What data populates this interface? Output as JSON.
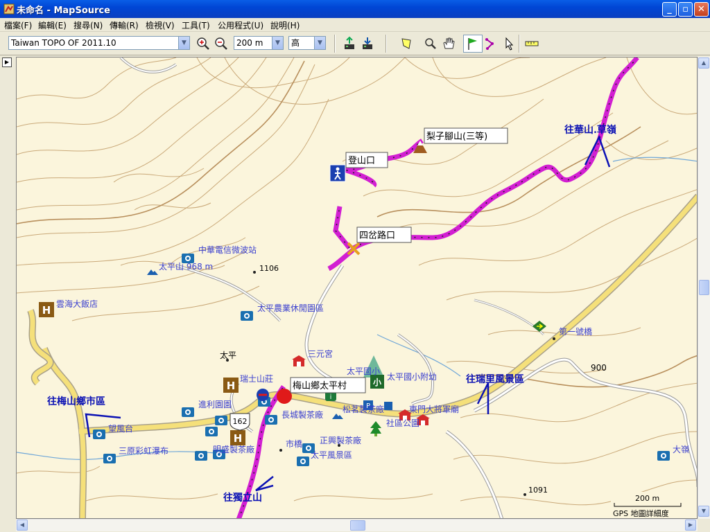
{
  "window": {
    "title": "未命名 - MapSource",
    "buttons": {
      "minimize": "_",
      "maximize": "▫",
      "close": "✕"
    }
  },
  "menu": {
    "items": [
      "檔案(F)",
      "編輯(E)",
      "搜尋(N)",
      "傳輸(R)",
      "檢視(V)",
      "工具(T)",
      "公用程式(U)",
      "說明(H)"
    ]
  },
  "toolbar": {
    "map_product": "Taiwan TOPO OF 2011.10",
    "zoom_scale": "200 m",
    "detail_level": "高",
    "icons": [
      "zoom-in-icon",
      "zoom-out-icon",
      "send-to-device-icon",
      "receive-from-device-icon",
      "select-map-icon",
      "zoom-tool-icon",
      "hand-pan-icon",
      "waypoint-flag-icon",
      "route-tool-icon",
      "pointer-icon",
      "measure-ruler-icon"
    ]
  },
  "map": {
    "pois": {
      "zhonghua_telecom": "中華電信微波站",
      "taiping_mountain": "太平山 968 m",
      "peak_1106": "1106",
      "yunhai_hotel": "雲海大飯店",
      "taiping_farm": "太平農業休閒園區",
      "taiping": "太平",
      "sanyuan_temple": "三元宮",
      "ruishi_lodge": "瑞士山莊",
      "jinli_garden": "進利園園",
      "taiping_elementary": "太平國小",
      "taiping_elem_kinder": "太平國小附幼",
      "changcheng_tea": "長城製茶廠",
      "songming_tea": "松茗製茶廠",
      "dongmen_temple": "東門大將軍廟",
      "community_park": "社區公園",
      "wangfeng_platform": "望風台",
      "sanyuan_rainbow": "三原彩虹瀑布",
      "tea_factory_a": "明盛製茶廠",
      "zhengxing_tea": "正興製茶廠",
      "market_bridge": "市橋",
      "taiping_scenic": "太平風景區",
      "first_bridge": "第一號橋",
      "elev_900": "900",
      "elev_1091": "1091",
      "daling": "大嶺",
      "road_162": "162"
    },
    "waypoints": {
      "trailhead": "登山口",
      "lizijiao_peak": "梨子腳山(三等)",
      "junction": "四岔路口",
      "meishan_taiping": "梅山鄉太平村"
    },
    "annotations": {
      "to_huashan": "往華山.草嶺",
      "to_ruili": "往瑞里風景區",
      "to_meishan": "往梅山鄉市區",
      "to_dulishan": "往獨立山"
    },
    "scale_bar": "200 m",
    "detail_label": "GPS 地圖詳細度",
    "colors": {
      "background": "#fbf5dc",
      "contour": "#c9a878",
      "route": "#d21fd2",
      "road": "#f5e07a",
      "road_edge": "#a8a08a",
      "label": "#3a3fcf",
      "annotation": "#0a10b4"
    }
  }
}
